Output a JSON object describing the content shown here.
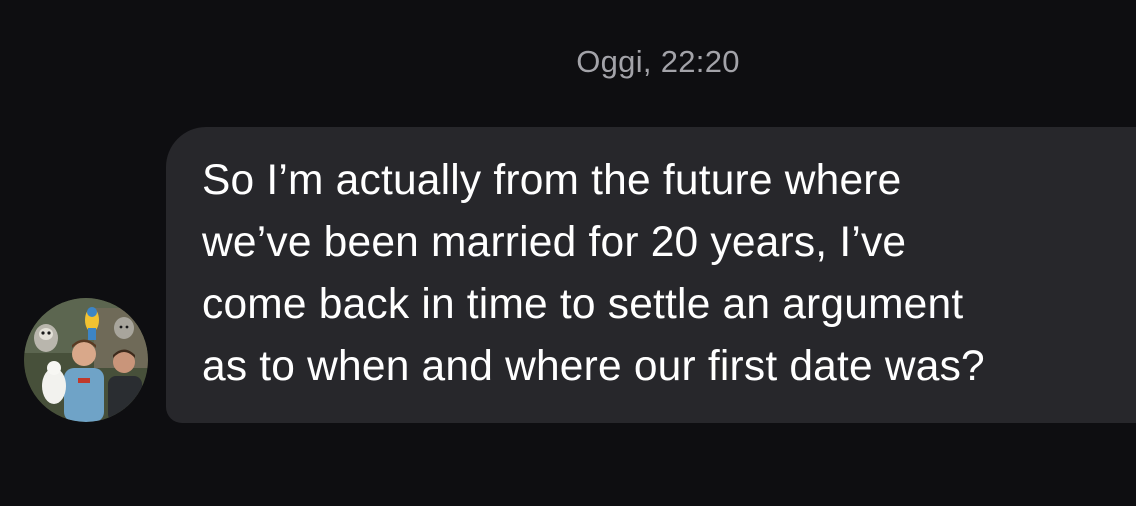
{
  "conversation": {
    "timestamp": "Oggi, 22:20",
    "messages": [
      {
        "sender_avatar": "profile-photo",
        "text": "So I’m actually from the future where\nwe’ve been married for 20 years, I’ve\ncome back in time to settle an argument\nas to when and where our first date was?"
      }
    ]
  },
  "colors": {
    "background": "#0e0e11",
    "bubble": "#27272b",
    "timestamp_text": "#a3a3a9",
    "message_text": "#ffffff"
  }
}
